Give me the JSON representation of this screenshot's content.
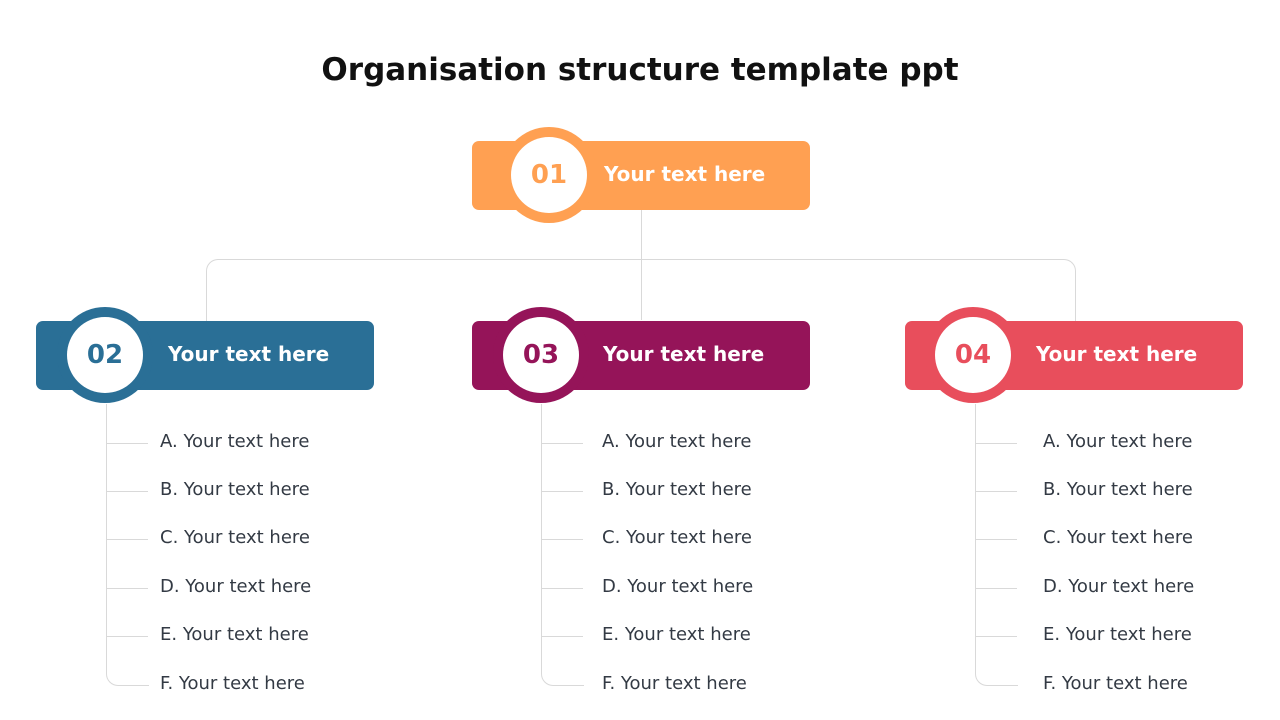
{
  "title": "Organisation structure template ppt",
  "colors": {
    "orange": "#ffa052",
    "blue": "#2a6f96",
    "purple": "#951459",
    "red": "#e84e5c",
    "line": "#d9d9d9",
    "text": "#333a44"
  },
  "nodes": [
    {
      "number": "01",
      "label": "Your text here",
      "color": "#ffa052"
    },
    {
      "number": "02",
      "label": "Your text here",
      "color": "#2a6f96"
    },
    {
      "number": "03",
      "label": "Your text here",
      "color": "#951459"
    },
    {
      "number": "04",
      "label": "Your text here",
      "color": "#e84e5c"
    }
  ],
  "lists": [
    {
      "items": [
        "A. Your text here",
        "B. Your text here",
        "C. Your text here",
        "D. Your text here",
        "E. Your text here",
        "F. Your text here"
      ]
    },
    {
      "items": [
        "A. Your text here",
        "B. Your text here",
        "C. Your text here",
        "D. Your text here",
        "E. Your text here",
        "F. Your text here"
      ]
    },
    {
      "items": [
        "A. Your text here",
        "B. Your text here",
        "C. Your text here",
        "D. Your text here",
        "E. Your text here",
        "F. Your text here"
      ]
    }
  ]
}
